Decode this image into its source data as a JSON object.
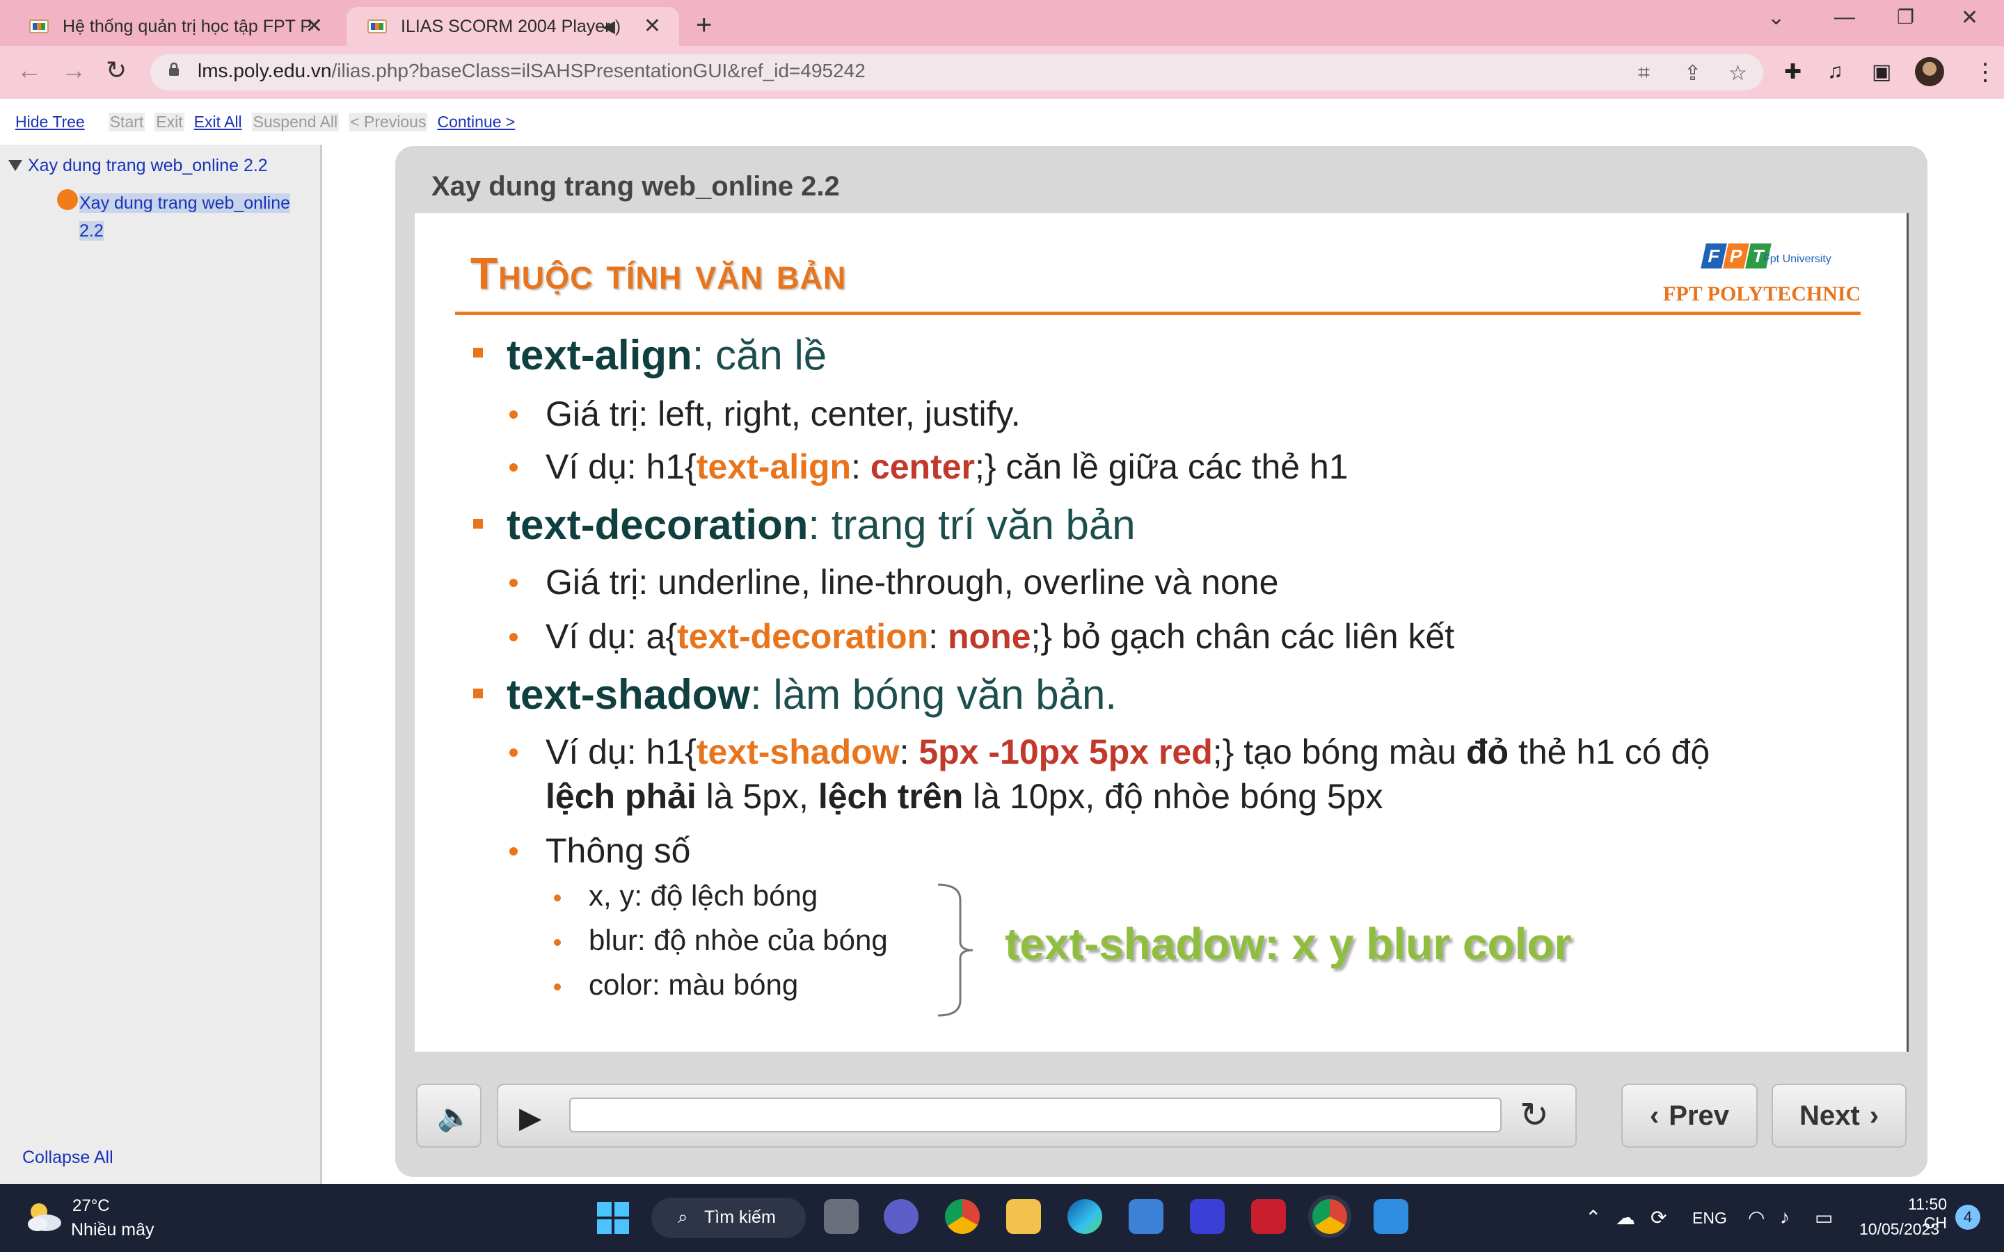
{
  "browser": {
    "tabs": [
      {
        "title": "Hệ thống quản trị học tập FPT Polytechnic"
      },
      {
        "title": "ILIAS SCORM 2004 Player"
      }
    ],
    "url_host": "lms.poly.edu.vn",
    "url_path": "/ilias.php?baseClass=ilSAHSPresentationGUI&ref_id=495242"
  },
  "scorm_nav": {
    "hide_tree": "Hide Tree",
    "start": "Start",
    "exit": "Exit",
    "exit_all": "Exit All",
    "suspend_all": "Suspend All",
    "previous": "< Previous",
    "continue": "Continue >"
  },
  "tree": {
    "root": "Xay dung trang web_online 2.2",
    "child": "Xay dung trang web_online 2.2",
    "collapse_all": "Collapse All"
  },
  "player": {
    "lesson_title": "Xay dung trang web_online 2.2",
    "prev": "Prev",
    "next": "Next"
  },
  "slide": {
    "title": "Thuộc tính văn bản",
    "logo_university": "Fpt University",
    "logo_poly": "FPT POLYTECHNIC",
    "align": {
      "prop": "text-align",
      "desc": ": căn lề",
      "values": "Giá trị: left, right, center, justify.",
      "ex_pre": "Ví dụ: h1{",
      "ex_prop": "text-align",
      "ex_colon": ": ",
      "ex_val": "center",
      "ex_post": ";} căn lề giữa các thẻ h1"
    },
    "decoration": {
      "prop": "text-decoration",
      "desc": ": trang trí văn bản",
      "values": "Giá trị: underline, line-through, overline và none",
      "ex_pre": "Ví dụ: a{",
      "ex_prop": "text-decoration",
      "ex_colon": ": ",
      "ex_val": "none",
      "ex_post": ";} bỏ gạch chân các liên kết"
    },
    "shadow": {
      "prop": "text-shadow",
      "desc": ": làm bóng văn bản.",
      "ex_pre": "Ví dụ: h1{",
      "ex_prop": "text-shadow",
      "ex_colon": ": ",
      "ex_val": "5px -10px 5px red",
      "ex_post1": ";} tạo bóng màu ",
      "ex_bold1": "đỏ",
      "ex_post2": " thẻ h1 có độ",
      "ex2_bold1": "lệch phải",
      "ex2_mid": " là 5px, ",
      "ex2_bold2": "lệch trên",
      "ex2_end": " là 10px, độ nhòe bóng 5px",
      "params_label": "Thông số",
      "param_xy": "x, y: độ lệch bóng",
      "param_blur": "blur: độ nhòe của bóng",
      "param_color": "color: màu bóng",
      "syntax": "text-shadow: x y blur color"
    }
  },
  "taskbar": {
    "temp": "27°C",
    "weather": "Nhiều mây",
    "search": "Tìm kiếm",
    "lang": "ENG",
    "time": "11:50 CH",
    "date": "10/05/2023",
    "notifications": "4"
  },
  "colors": {
    "accent_orange": "#e8741c",
    "dark_teal": "#0f3f3f",
    "example_red": "#c0392b",
    "syntax_green": "#8fbe3f",
    "link_blue": "#1a33b8"
  }
}
